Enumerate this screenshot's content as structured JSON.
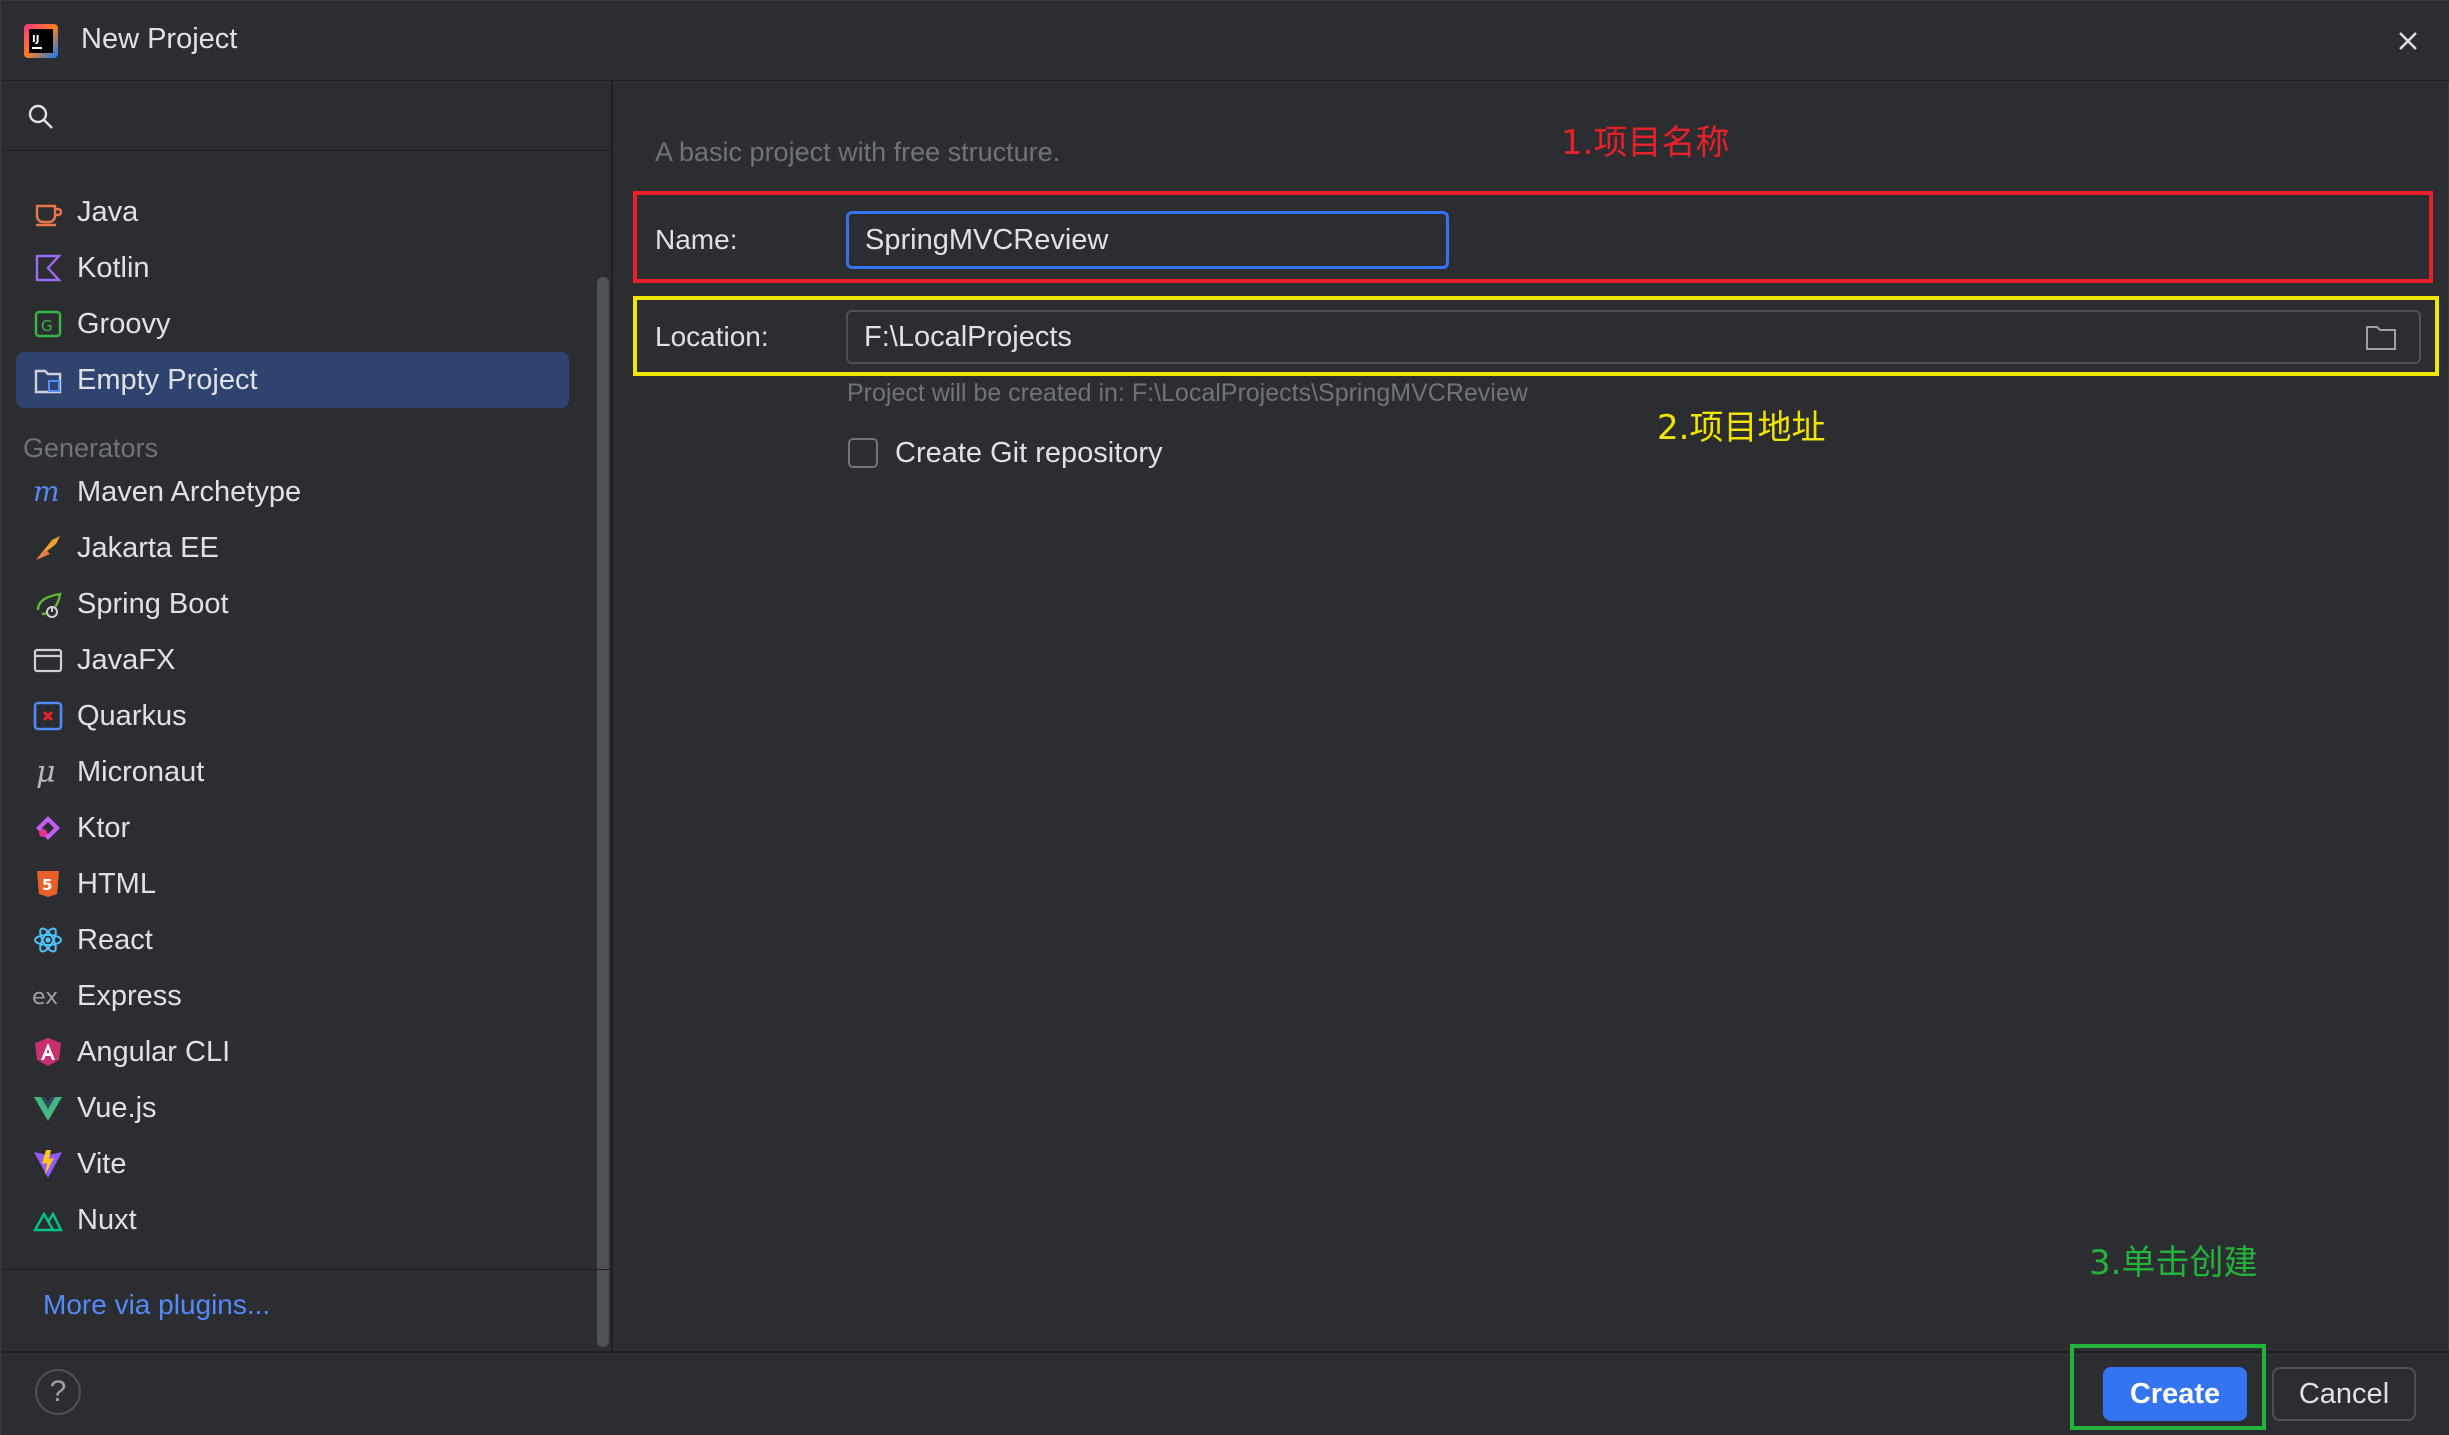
{
  "window": {
    "title": "New Project"
  },
  "sidebar": {
    "search_placeholder": "",
    "top_items": [
      {
        "label": "Java",
        "icon": "java-icon"
      },
      {
        "label": "Kotlin",
        "icon": "kotlin-icon"
      },
      {
        "label": "Groovy",
        "icon": "groovy-icon"
      },
      {
        "label": "Empty Project",
        "icon": "empty-project-icon",
        "selected": true
      }
    ],
    "generators_header": "Generators",
    "generators": [
      {
        "label": "Maven Archetype",
        "icon": "maven-icon"
      },
      {
        "label": "Jakarta EE",
        "icon": "jakarta-icon"
      },
      {
        "label": "Spring Boot",
        "icon": "spring-boot-icon"
      },
      {
        "label": "JavaFX",
        "icon": "javafx-icon"
      },
      {
        "label": "Quarkus",
        "icon": "quarkus-icon"
      },
      {
        "label": "Micronaut",
        "icon": "micronaut-icon"
      },
      {
        "label": "Ktor",
        "icon": "ktor-icon"
      },
      {
        "label": "HTML",
        "icon": "html-icon"
      },
      {
        "label": "React",
        "icon": "react-icon"
      },
      {
        "label": "Express",
        "icon": "express-icon"
      },
      {
        "label": "Angular CLI",
        "icon": "angular-icon"
      },
      {
        "label": "Vue.js",
        "icon": "vue-icon"
      },
      {
        "label": "Vite",
        "icon": "vite-icon"
      },
      {
        "label": "Nuxt",
        "icon": "nuxt-icon"
      }
    ],
    "more_plugins": "More via plugins..."
  },
  "main": {
    "description": "A basic project with free structure.",
    "name_label": "Name:",
    "name_value": "SpringMVCReview",
    "location_label": "Location:",
    "location_value": "F:\\LocalProjects",
    "created_in_hint": "Project will be created in: F:\\LocalProjects\\SpringMVCReview",
    "git_checkbox_label": "Create Git repository",
    "git_checked": false
  },
  "annotations": {
    "name": "1.项目名称",
    "location": "2.项目地址",
    "create": "3.单击创建"
  },
  "footer": {
    "help": "?",
    "create": "Create",
    "cancel": "Cancel"
  },
  "colors": {
    "background": "#2b2d30",
    "accent": "#3574f0",
    "selected": "#2e436e",
    "link": "#548af7",
    "annotation_red": "#e8202a",
    "annotation_yellow": "#f2e600",
    "annotation_green": "#21b33a"
  }
}
